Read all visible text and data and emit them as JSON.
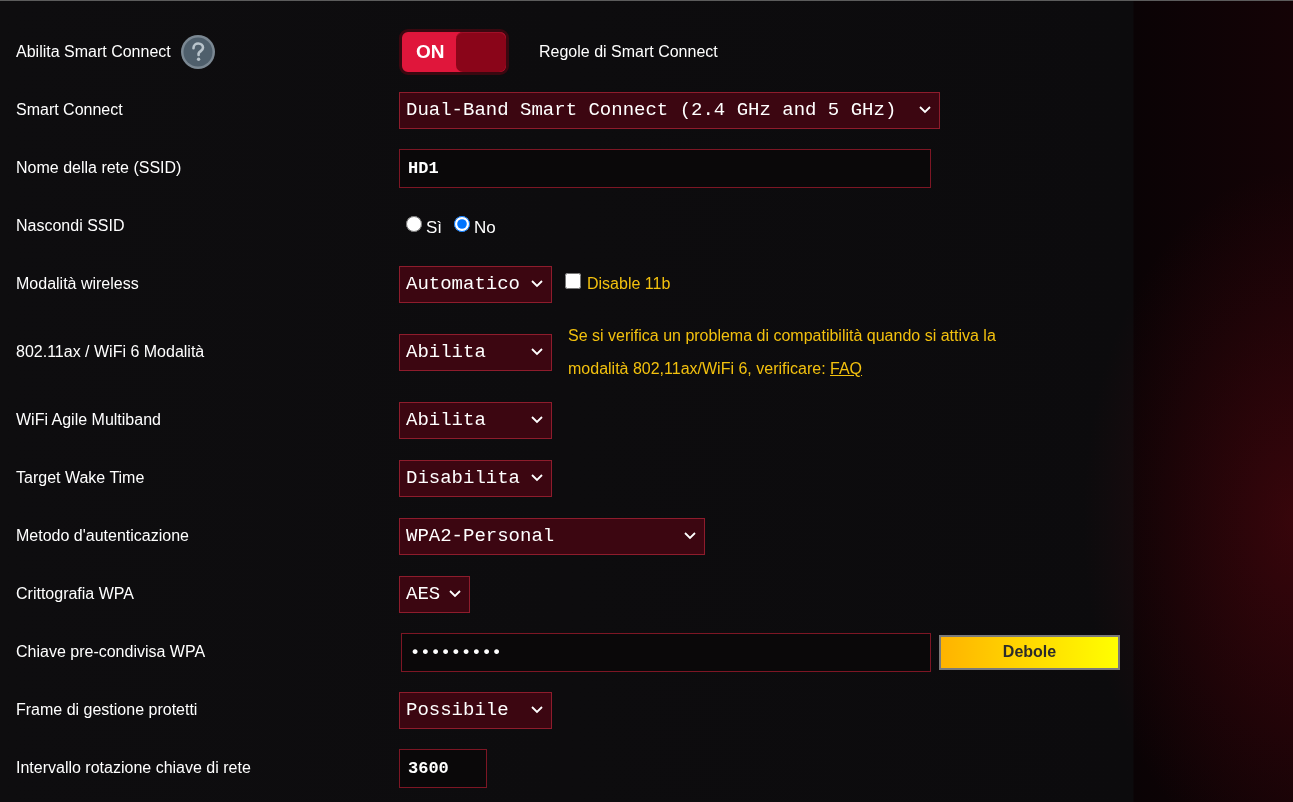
{
  "rows": [
    {
      "kind": "toggle",
      "label": "Abilita Smart Connect",
      "help": true,
      "toggle": {
        "text": "ON",
        "on": true
      },
      "link": "Regole di Smart Connect"
    },
    {
      "kind": "select",
      "label": "Smart Connect",
      "value": "Dual-Band Smart Connect (2.4 GHz and 5 GHz)"
    },
    {
      "kind": "text",
      "label": "Nome della rete (SSID)",
      "value": "HD1"
    },
    {
      "kind": "radio",
      "label": "Nascondi SSID",
      "options": [
        {
          "label": "Sì",
          "selected": false
        },
        {
          "label": "No",
          "selected": true
        }
      ]
    },
    {
      "kind": "select",
      "label": "Modalità wireless",
      "value": "Automatico",
      "checkbox": {
        "label": "Disable 11b",
        "checked": false
      }
    },
    {
      "kind": "select",
      "label": "802.11ax / WiFi 6 Modalità",
      "value": "Abilita",
      "note": {
        "text": "Se si verifica un problema di compatibilità quando si attiva la modalità 802,11ax/WiFi 6, verificare: ",
        "link": "FAQ"
      }
    },
    {
      "kind": "select",
      "label": "WiFi Agile Multiband",
      "value": "Abilita"
    },
    {
      "kind": "select",
      "label": "Target Wake Time",
      "value": "Disabilita"
    },
    {
      "kind": "select",
      "label": "Metodo d'autenticazione",
      "value": "WPA2-Personal"
    },
    {
      "kind": "select",
      "label": "Crittografia WPA",
      "value": "AES"
    },
    {
      "kind": "password",
      "label": "Chiave pre-condivisa WPA",
      "value": "•••••••••",
      "strength": "Debole"
    },
    {
      "kind": "select",
      "label": "Frame di gestione protetti",
      "value": "Possibile"
    },
    {
      "kind": "text",
      "label": "Intervallo rotazione chiave di rete",
      "value": "3600"
    }
  ]
}
